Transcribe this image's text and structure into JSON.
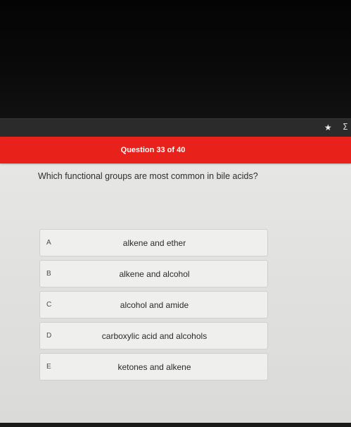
{
  "browser": {
    "bookmark_icon": "star-icon",
    "extension_icon": "extension-icon"
  },
  "quiz": {
    "counter": "Question 33 of 40",
    "question": "Which functional groups are most common in bile acids?",
    "options": [
      {
        "letter": "A",
        "text": "alkene and ether"
      },
      {
        "letter": "B",
        "text": "alkene and alcohol"
      },
      {
        "letter": "C",
        "text": "alcohol and amide"
      },
      {
        "letter": "D",
        "text": "carboxylic acid and alcohols"
      },
      {
        "letter": "E",
        "text": "ketones and alkene"
      }
    ]
  },
  "colors": {
    "header_red": "#e8211b",
    "page_bg": "#e2e2e0",
    "option_bg": "#efefed"
  }
}
